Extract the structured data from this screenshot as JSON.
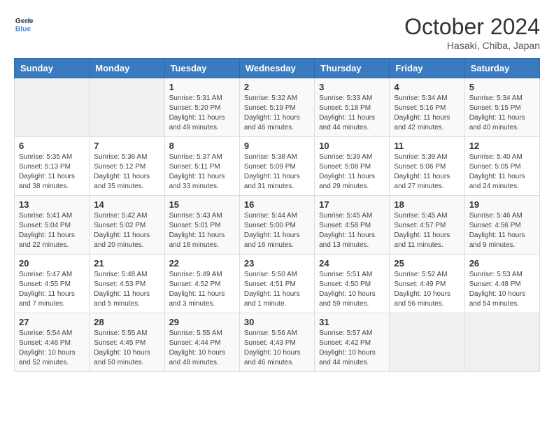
{
  "header": {
    "logo_line1": "General",
    "logo_line2": "Blue",
    "month": "October 2024",
    "location": "Hasaki, Chiba, Japan"
  },
  "weekdays": [
    "Sunday",
    "Monday",
    "Tuesday",
    "Wednesday",
    "Thursday",
    "Friday",
    "Saturday"
  ],
  "weeks": [
    [
      {
        "day": "",
        "info": ""
      },
      {
        "day": "",
        "info": ""
      },
      {
        "day": "1",
        "info": "Sunrise: 5:31 AM\nSunset: 5:20 PM\nDaylight: 11 hours and 49 minutes."
      },
      {
        "day": "2",
        "info": "Sunrise: 5:32 AM\nSunset: 5:19 PM\nDaylight: 11 hours and 46 minutes."
      },
      {
        "day": "3",
        "info": "Sunrise: 5:33 AM\nSunset: 5:18 PM\nDaylight: 11 hours and 44 minutes."
      },
      {
        "day": "4",
        "info": "Sunrise: 5:34 AM\nSunset: 5:16 PM\nDaylight: 11 hours and 42 minutes."
      },
      {
        "day": "5",
        "info": "Sunrise: 5:34 AM\nSunset: 5:15 PM\nDaylight: 11 hours and 40 minutes."
      }
    ],
    [
      {
        "day": "6",
        "info": "Sunrise: 5:35 AM\nSunset: 5:13 PM\nDaylight: 11 hours and 38 minutes."
      },
      {
        "day": "7",
        "info": "Sunrise: 5:36 AM\nSunset: 5:12 PM\nDaylight: 11 hours and 35 minutes."
      },
      {
        "day": "8",
        "info": "Sunrise: 5:37 AM\nSunset: 5:11 PM\nDaylight: 11 hours and 33 minutes."
      },
      {
        "day": "9",
        "info": "Sunrise: 5:38 AM\nSunset: 5:09 PM\nDaylight: 11 hours and 31 minutes."
      },
      {
        "day": "10",
        "info": "Sunrise: 5:39 AM\nSunset: 5:08 PM\nDaylight: 11 hours and 29 minutes."
      },
      {
        "day": "11",
        "info": "Sunrise: 5:39 AM\nSunset: 5:06 PM\nDaylight: 11 hours and 27 minutes."
      },
      {
        "day": "12",
        "info": "Sunrise: 5:40 AM\nSunset: 5:05 PM\nDaylight: 11 hours and 24 minutes."
      }
    ],
    [
      {
        "day": "13",
        "info": "Sunrise: 5:41 AM\nSunset: 5:04 PM\nDaylight: 11 hours and 22 minutes."
      },
      {
        "day": "14",
        "info": "Sunrise: 5:42 AM\nSunset: 5:02 PM\nDaylight: 11 hours and 20 minutes."
      },
      {
        "day": "15",
        "info": "Sunrise: 5:43 AM\nSunset: 5:01 PM\nDaylight: 11 hours and 18 minutes."
      },
      {
        "day": "16",
        "info": "Sunrise: 5:44 AM\nSunset: 5:00 PM\nDaylight: 11 hours and 16 minutes."
      },
      {
        "day": "17",
        "info": "Sunrise: 5:45 AM\nSunset: 4:58 PM\nDaylight: 11 hours and 13 minutes."
      },
      {
        "day": "18",
        "info": "Sunrise: 5:45 AM\nSunset: 4:57 PM\nDaylight: 11 hours and 11 minutes."
      },
      {
        "day": "19",
        "info": "Sunrise: 5:46 AM\nSunset: 4:56 PM\nDaylight: 11 hours and 9 minutes."
      }
    ],
    [
      {
        "day": "20",
        "info": "Sunrise: 5:47 AM\nSunset: 4:55 PM\nDaylight: 11 hours and 7 minutes."
      },
      {
        "day": "21",
        "info": "Sunrise: 5:48 AM\nSunset: 4:53 PM\nDaylight: 11 hours and 5 minutes."
      },
      {
        "day": "22",
        "info": "Sunrise: 5:49 AM\nSunset: 4:52 PM\nDaylight: 11 hours and 3 minutes."
      },
      {
        "day": "23",
        "info": "Sunrise: 5:50 AM\nSunset: 4:51 PM\nDaylight: 11 hours and 1 minute."
      },
      {
        "day": "24",
        "info": "Sunrise: 5:51 AM\nSunset: 4:50 PM\nDaylight: 10 hours and 59 minutes."
      },
      {
        "day": "25",
        "info": "Sunrise: 5:52 AM\nSunset: 4:49 PM\nDaylight: 10 hours and 56 minutes."
      },
      {
        "day": "26",
        "info": "Sunrise: 5:53 AM\nSunset: 4:48 PM\nDaylight: 10 hours and 54 minutes."
      }
    ],
    [
      {
        "day": "27",
        "info": "Sunrise: 5:54 AM\nSunset: 4:46 PM\nDaylight: 10 hours and 52 minutes."
      },
      {
        "day": "28",
        "info": "Sunrise: 5:55 AM\nSunset: 4:45 PM\nDaylight: 10 hours and 50 minutes."
      },
      {
        "day": "29",
        "info": "Sunrise: 5:55 AM\nSunset: 4:44 PM\nDaylight: 10 hours and 48 minutes."
      },
      {
        "day": "30",
        "info": "Sunrise: 5:56 AM\nSunset: 4:43 PM\nDaylight: 10 hours and 46 minutes."
      },
      {
        "day": "31",
        "info": "Sunrise: 5:57 AM\nSunset: 4:42 PM\nDaylight: 10 hours and 44 minutes."
      },
      {
        "day": "",
        "info": ""
      },
      {
        "day": "",
        "info": ""
      }
    ]
  ]
}
